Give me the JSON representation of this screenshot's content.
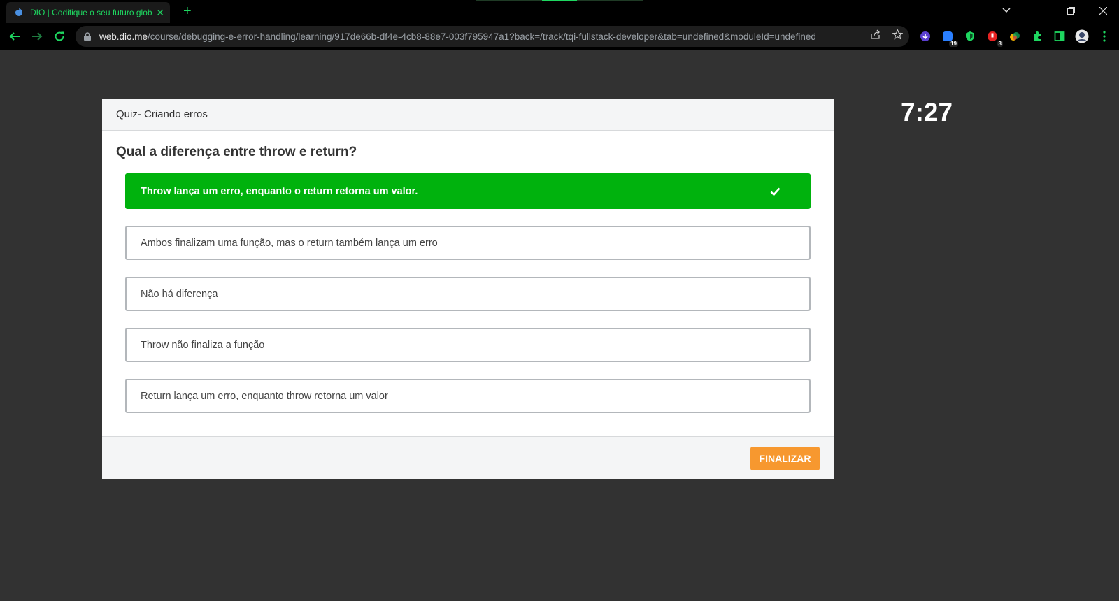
{
  "browser": {
    "tab_title": "DIO | Codifique o seu futuro global",
    "url_host": "web.dio.me",
    "url_path": "/course/debugging-e-error-handling/learning/917de66b-df4e-4cb8-88e7-003f795947a1?back=/track/tqi-fullstack-developer&tab=undefined&moduleId=undefined",
    "extension_badges": {
      "ext2": "19",
      "ext4": "3"
    },
    "accent_color": "#1ed760"
  },
  "quiz": {
    "header_title": "Quiz- Criando erros",
    "question": "Qual a diferença entre throw e return?",
    "options": [
      {
        "label": "Throw lança um erro, enquanto o return retorna um valor.",
        "state": "correct"
      },
      {
        "label": "Ambos finalizam uma função, mas o return também lança um erro",
        "state": "default"
      },
      {
        "label": "Não há diferença",
        "state": "default"
      },
      {
        "label": "Throw não finaliza a função",
        "state": "default"
      },
      {
        "label": "Return lança um erro, enquanto throw retorna um valor",
        "state": "default"
      }
    ],
    "finish_label": "FINALIZAR",
    "correct_color": "#00b20d",
    "finish_color": "#f7982f"
  },
  "timer": "7:27"
}
